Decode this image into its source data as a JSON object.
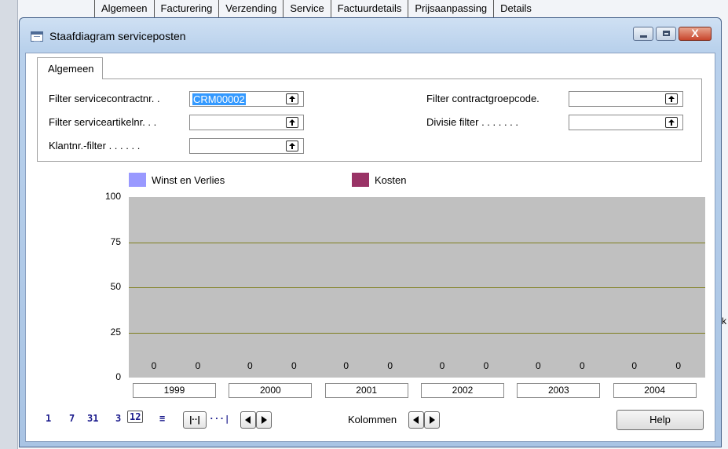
{
  "background": {
    "tabs": [
      "Algemeen",
      "Facturering",
      "Verzending",
      "Service",
      "Factuurdetails",
      "Prijsaanpassing",
      "Details"
    ],
    "right_fragment": "k"
  },
  "window": {
    "title": "Staafdiagram serviceposten",
    "close_label": "X"
  },
  "tab": {
    "label": "Algemeen"
  },
  "filters": {
    "left": [
      {
        "label": "Filter servicecontractnr. .",
        "value": "CRM00002"
      },
      {
        "label": "Filter serviceartikelnr. . .",
        "value": ""
      },
      {
        "label": "Klantnr.-filter . . . . . .",
        "value": ""
      }
    ],
    "right": [
      {
        "label": "Filter contractgroepcode.",
        "value": ""
      },
      {
        "label": "Divisie filter . . . . . . .",
        "value": ""
      }
    ]
  },
  "chart_data": {
    "type": "bar",
    "categories": [
      "1999",
      "2000",
      "2001",
      "2002",
      "2003",
      "2004"
    ],
    "series": [
      {
        "name": "Winst en Verlies",
        "color": "#9999ff",
        "values": [
          0,
          0,
          0,
          0,
          0,
          0
        ]
      },
      {
        "name": "Kosten",
        "color": "#993366",
        "values": [
          0,
          0,
          0,
          0,
          0,
          0
        ]
      }
    ],
    "ylim": [
      0,
      100
    ],
    "yticks": [
      "100",
      "75",
      "50",
      "25",
      "0"
    ],
    "plot_background": "#c0c0c0",
    "grid_color": "#7f7f1f",
    "grid": true,
    "legend_position": "top"
  },
  "toolbar": {
    "periods": [
      "1",
      "7",
      "31",
      "3",
      "12"
    ],
    "selected_period": "12",
    "list_glyph": "≡",
    "zoom_full": "|··|",
    "zoom_partial": "···|",
    "columns_label": "Kolommen",
    "help_label": "Help"
  }
}
